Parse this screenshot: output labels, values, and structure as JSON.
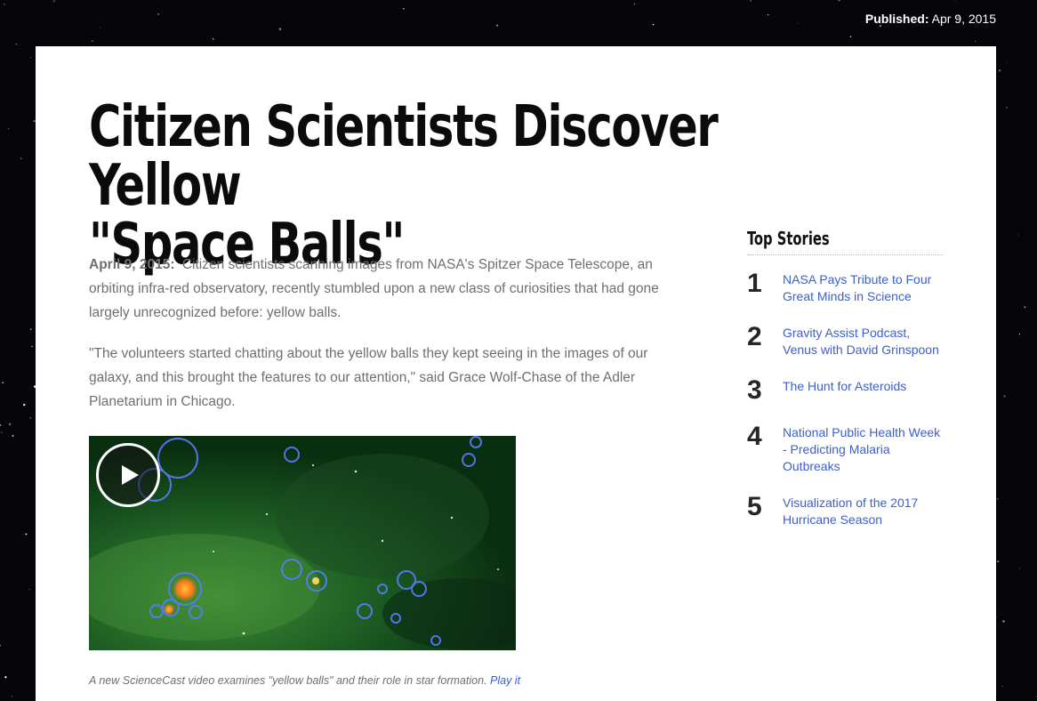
{
  "meta": {
    "published_label": "Published:",
    "published_date": "Apr 9, 2015"
  },
  "article": {
    "title_line1": "Citizen Scientists Discover Yellow",
    "title_line2": "\"Space Balls\"",
    "dateline": "April 9, 2015:",
    "paragraph1": "Citizen scientists scanning images from NASA's Spitzer Space Telescope, an orbiting infra-red observatory, recently stumbled upon a new class of curiosities that had gone largely unrecognized before: yellow balls.",
    "paragraph2": "\"The volunteers started chatting about the yellow balls they kept seeing in the images of our galaxy, and this brought the features to our attention,\" said Grace Wolf-Chase of the Adler Planetarium in Chicago.",
    "caption_text": "A new ScienceCast video examines \"yellow balls\" and their role in star formation.",
    "caption_link": "Play it"
  },
  "sidebar": {
    "title": "Top Stories",
    "stories": [
      {
        "num": "1",
        "label": "NASA Pays Tribute to Four Great Minds in Science"
      },
      {
        "num": "2",
        "label": "Gravity Assist Podcast, Venus with David Grinspoon"
      },
      {
        "num": "3",
        "label": "The Hunt for Asteroids"
      },
      {
        "num": "4",
        "label": "National Public Health Week - Predicting Malaria Outbreaks"
      },
      {
        "num": "5",
        "label": "Visualization of the 2017 Hurricane Season"
      }
    ]
  },
  "icons": {
    "play": "play-icon"
  },
  "colors": {
    "link": "#3d5fc8",
    "background": "#05050a",
    "panel": "#ffffff"
  }
}
